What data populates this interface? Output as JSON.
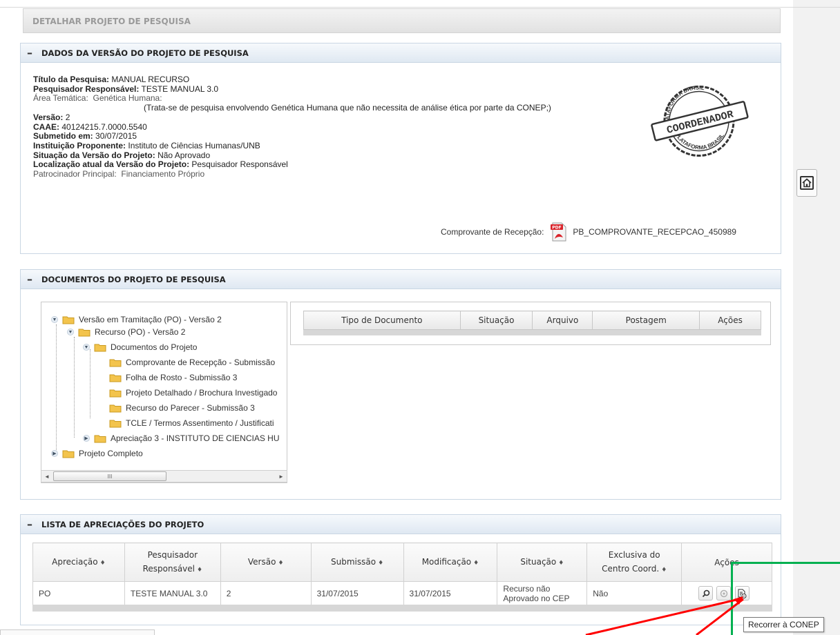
{
  "page_title": "DETALHAR PROJETO DE PESQUISA",
  "panel_version": {
    "title": "DADOS DA VERSÃO DO PROJETO DE PESQUISA",
    "toggle": "–",
    "fields": {
      "titulo_label": "Título da Pesquisa:",
      "titulo_value": "MANUAL RECURSO",
      "pesquisador_label": "Pesquisador Responsável:",
      "pesquisador_value": "TESTE MANUAL 3.0",
      "area_label": "Área Temática:",
      "area_value": "Genética Humana:",
      "area_note": "(Trata-se de pesquisa envolvendo Genética Humana que não necessita de análise ética por parte da CONEP;)",
      "versao_label": "Versão:",
      "versao_value": "2",
      "caae_label": "CAAE:",
      "caae_value": "40124215.7.0000.5540",
      "submetido_label": "Submetido em:",
      "submetido_value": "30/07/2015",
      "instituicao_label": "Instituição Proponente:",
      "instituicao_value": "Instituto de Ciências Humanas/UNB",
      "situacao_label": "Situação da Versão do Projeto:",
      "situacao_value": "Não Aprovado",
      "localizacao_label": "Localização atual da Versão do Projeto:",
      "localizacao_value": "Pesquisador Responsável",
      "patrocinador_label": "Patrocinador Principal:",
      "patrocinador_value": "Financiamento Próprio"
    },
    "stamp": {
      "top_text": "PLATAFORMA BRASIL",
      "center_text": "COORDENADOR",
      "bottom_text": "PLATAFORMA BRASIL"
    },
    "comprovante_label": "Comprovante de Recepção:",
    "comprovante_file": "PB_COMPROVANTE_RECEPCAO_450989",
    "pdf_badge": "PDF"
  },
  "panel_docs": {
    "title": "DOCUMENTOS DO PROJETO DE PESQUISA",
    "toggle": "–",
    "tree": [
      "Versão em Tramitação (PO) - Versão 2",
      "Recurso (PO) - Versão 2",
      "Documentos do Projeto",
      "Comprovante de Recepção - Submissão",
      "Folha de Rosto - Submissão 3",
      "Projeto Detalhado / Brochura Investigado",
      "Recurso do Parecer - Submissão 3",
      "TCLE / Termos Assentimento / Justificati",
      "Apreciação 3 - INSTITUTO DE CIENCIAS HU",
      "Projeto Completo"
    ],
    "scroll_left": "◄",
    "scroll_right": "►",
    "scroll_grip": "III",
    "table_headers": [
      "Tipo de Documento",
      "Situação",
      "Arquivo",
      "Postagem",
      "Ações"
    ]
  },
  "panel_apr": {
    "title": "LISTA DE APRECIAÇÕES DO PROJETO",
    "toggle": "–",
    "headers": {
      "apreciacao": "Apreciação",
      "pesquisador_1": "Pesquisador",
      "pesquisador_2": "Responsável",
      "versao": "Versão",
      "submissao": "Submissão",
      "modificacao": "Modificação",
      "situacao": "Situação",
      "exclusiva_1": "Exclusiva do",
      "exclusiva_2": "Centro Coord.",
      "acoes": "Ações",
      "sort_glyph": "♦"
    },
    "row": {
      "apreciacao": "PO",
      "pesquisador": "TESTE MANUAL 3.0",
      "versao": "2",
      "submissao": "31/07/2015",
      "modificacao": "31/07/2015",
      "situacao_1": "Recurso não",
      "situacao_2": "Aprovado no CEP",
      "exclusiva": "Não"
    },
    "action_icons": [
      "magnifier-icon",
      "disabled-circle-icon",
      "recorrer-document-icon"
    ]
  },
  "tooltip": "Recorrer à CONEP",
  "colors": {
    "panel_border": "#c9d6e3",
    "panel_head": "#dfe8f2",
    "highlight_box": "#00b050",
    "arrow": "#ff0000",
    "pdf_red": "#d9232a",
    "folder": "#f3c44d"
  }
}
